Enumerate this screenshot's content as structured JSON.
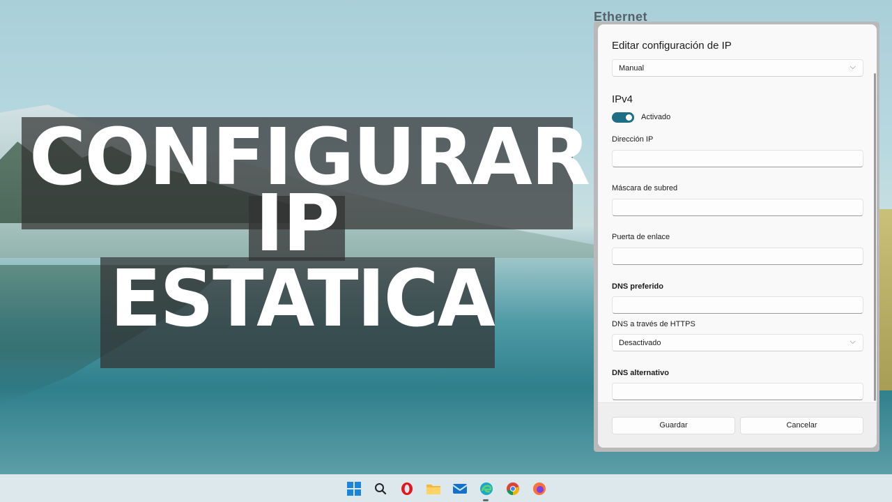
{
  "overlay": {
    "line1": "CONFIGURAR",
    "line2": "IP",
    "line3": "ESTATICA"
  },
  "background_window": {
    "header_text": "Ethernet",
    "footer_text": ""
  },
  "dialog": {
    "title": "Editar configuración de IP",
    "mode_select": "Manual",
    "section": "IPv4",
    "toggle_label": "Activado",
    "toggle_on": true,
    "fields": {
      "ip_address": {
        "label": "Dirección IP",
        "value": ""
      },
      "subnet_mask": {
        "label": "Máscara de subred",
        "value": ""
      },
      "gateway": {
        "label": "Puerta de enlace",
        "value": ""
      },
      "preferred_dns": {
        "label": "DNS preferido",
        "value": ""
      },
      "dns_https": {
        "label": "DNS a través de HTTPS",
        "value": "Desactivado"
      },
      "alternate_dns": {
        "label": "DNS alternativo",
        "value": ""
      }
    },
    "save_button": "Guardar",
    "cancel_button": "Cancelar"
  },
  "taskbar": {
    "icons": [
      "windows-start-icon",
      "search-icon",
      "opera-icon",
      "file-explorer-icon",
      "mail-icon",
      "edge-icon",
      "chrome-icon",
      "firefox-icon"
    ],
    "accent": "#1a86d9"
  },
  "colors": {
    "toggle": "#1e6f86",
    "banner": "#323232"
  }
}
